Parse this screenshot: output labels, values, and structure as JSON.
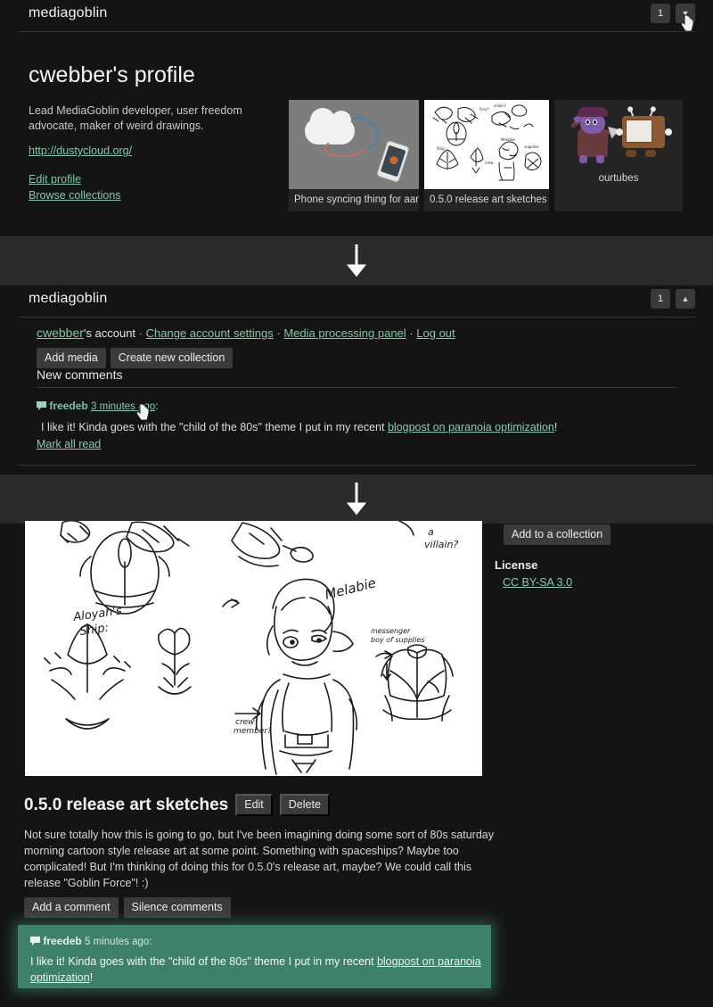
{
  "site": {
    "name": "mediagoblin"
  },
  "header": {
    "notification_count": "1",
    "toggle_down_icon": "chevron-down-icon",
    "toggle_up_icon": "chevron-up-icon"
  },
  "profile": {
    "title": "cwebber's profile",
    "bio": "Lead MediaGoblin developer, user freedom advocate, maker of weird drawings.",
    "website": "http://dustycloud.org/",
    "edit_profile": "Edit profile",
    "browse_collections": "Browse collections",
    "media": [
      {
        "caption": "Phone syncing thing for aar",
        "kind": "phone-sync-drawing"
      },
      {
        "caption": "0.5.0 release art sketches",
        "kind": "sketch-sheet"
      },
      {
        "caption": "ourtubes",
        "kind": "goblin-and-tv"
      }
    ]
  },
  "account": {
    "username": "cwebber",
    "account_suffix": "'s account",
    "separator": "·",
    "links": [
      "Change account settings",
      "Media processing panel",
      "Log out"
    ],
    "add_media_label": "Add media",
    "create_collection_label": "Create new collection",
    "new_comments_heading": "New comments",
    "notification": {
      "icon": "comment-bubble-icon",
      "author": "freedeb",
      "time": "3 minutes ago",
      "colon": ":",
      "body_before": "I like it! Kinda goes with the \"child of the 80s\" theme I put in my recent ",
      "body_link": "blogpost on paranoia optimization",
      "body_after": "!"
    },
    "mark_all_read": "Mark all read"
  },
  "detail": {
    "add_to_collection_label": "Add to a collection",
    "license_heading": "License",
    "license_value": "CC BY-SA 3.0",
    "title": "0.5.0 release art sketches",
    "edit_label": "Edit",
    "delete_label": "Delete",
    "description": "Not sure totally how this is going to go, but I've been imagining doing some sort of 80s saturday morning cartoon style release art at some point. Something with spaceships? Maybe too complicated! But I'm thinking of doing this for 0.5.0's release art, maybe? We could call this release \"Goblin Force\"! :)",
    "add_comment_label": "Add a comment",
    "silence_comments_label": "Silence comments",
    "highlighted_comment": {
      "icon": "comment-bubble-icon",
      "author": "freedeb",
      "time": "5 minutes ago",
      "colon": ":",
      "body_before": "I like it! Kinda goes with the \"child of the 80s\" theme I put in my recent ",
      "body_link": "blogpost on paranoia optimization",
      "body_after": "!",
      "highlight_color": "#3c8168"
    }
  },
  "separators": {
    "arrow_icon": "down-arrow-icon",
    "band_color": "#2b2b2b"
  },
  "sketch_labels": {
    "ship": "Aloyah's Ship:",
    "character": "Melabie",
    "villain": "a villain?",
    "crew": "crew member?",
    "messenger": "messenger boy of supplies"
  },
  "cursor": {
    "icon": "pointer-hand-cursor"
  },
  "colors": {
    "page_background": "#141414",
    "link": "#86c7a8",
    "button": "#3b3b3b",
    "text": "#e4e4e4"
  }
}
